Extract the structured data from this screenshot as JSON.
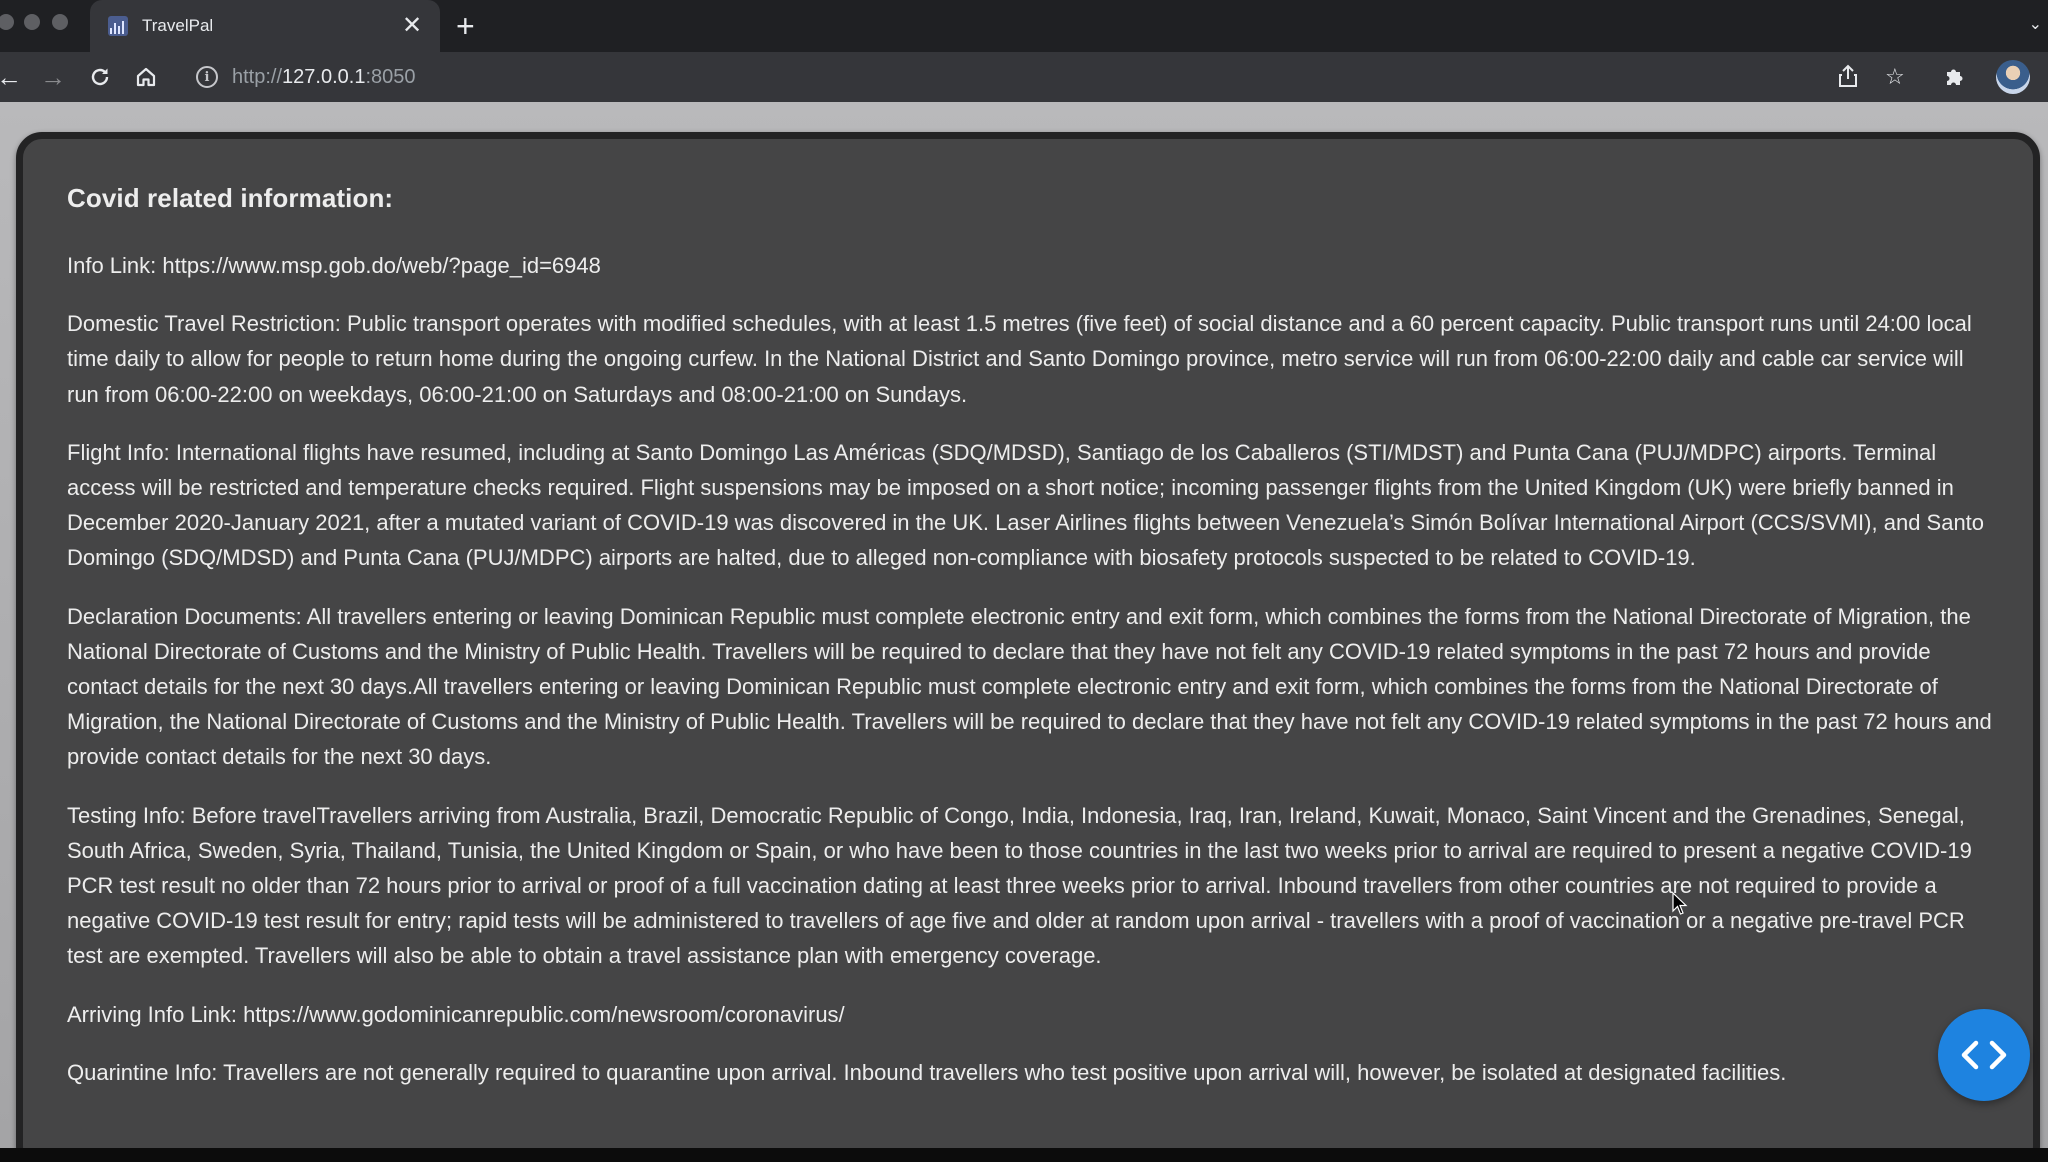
{
  "browser": {
    "tab_title": "TravelPal",
    "tab_close": "✕",
    "new_tab": "+",
    "url_scheme": "http://",
    "url_host": "127.0.0.1",
    "url_port": ":8050",
    "icons": [
      "back-icon",
      "forward-icon",
      "reload-icon",
      "home-icon",
      "info-icon",
      "share-icon",
      "bookmark-star-icon",
      "extensions-icon",
      "profile-avatar"
    ]
  },
  "page": {
    "heading": "Covid related information:",
    "info_link": "Info Link: https://www.msp.gob.do/web/?page_id=6948",
    "domestic": "Domestic Travel Restriction: Public transport operates with modified schedules, with at least 1.5 metres (five feet) of social distance and a 60 percent capacity. Public transport runs until 24:00 local time daily to allow for people to return home during the ongoing curfew. In the National District and Santo Domingo province, metro service will run from 06:00-22:00 daily and cable car service will run from 06:00-22:00 on weekdays, 06:00-21:00 on Saturdays and 08:00-21:00 on Sundays.",
    "flight": "Flight Info: International flights have resumed, including at Santo Domingo Las Américas (SDQ/MDSD), Santiago de los Caballeros (STI/MDST) and Punta Cana (PUJ/MDPC) airports. Terminal access will be restricted and temperature checks required. Flight suspensions may be imposed on a short notice; incoming passenger flights from the United Kingdom (UK) were briefly banned in December 2020-January 2021, after a mutated variant of COVID-19 was discovered in the UK. Laser Airlines flights between Venezuela’s Simón Bolívar International Airport (CCS/SVMI), and Santo Domingo (SDQ/MDSD) and Punta Cana (PUJ/MDPC) airports are halted, due to alleged non-compliance with biosafety protocols suspected to be related to COVID-19.",
    "declaration": "Declaration Documents: All travellers entering or leaving Dominican Republic must complete electronic entry and exit form, which combines the forms from the National Directorate of Migration, the National Directorate of Customs and the Ministry of Public Health. Travellers will be required to declare that they have not felt any COVID-19 related symptoms in the past 72 hours and provide contact details for the next 30 days.All travellers entering or leaving Dominican Republic must complete electronic entry and exit form, which combines the forms from the National Directorate of Migration, the National Directorate of Customs and the Ministry of Public Health. Travellers will be required to declare that they have not felt any COVID-19 related symptoms in the past 72 hours and provide contact details for the next 30 days.",
    "testing": "Testing Info: Before travelTravellers arriving from Australia, Brazil, Democratic Republic of Congo, India, Indonesia, Iraq, Iran, Ireland, Kuwait, Monaco, Saint Vincent and the Grenadines, Senegal, South Africa, Sweden, Syria, Thailand, Tunisia, the United Kingdom or Spain, or who have been to those countries in the last two weeks prior to arrival are required to present a negative COVID-19 PCR test result no older than 72 hours prior to arrival or proof of a full vaccination dating at least three weeks prior to arrival. Inbound travellers from other countries are not required to provide a negative COVID-19 test result for entry; rapid tests will be administered to travellers of age five and older at random upon arrival - travellers with a proof of vaccination or a negative pre-travel PCR test are exempted. Travellers will also be able to obtain a travel assistance plan with emergency coverage.",
    "arriving_link": "Arriving Info Link: https://www.godominicanrepublic.com/newsroom/coronavirus/",
    "quarantine": "Quarintine Info: Travellers are not generally required to quarantine upon arrival. Inbound travellers who test positive upon arrival will, however, be isolated at designated facilities."
  },
  "colors": {
    "card_bg": "#454546",
    "card_border": "#232324",
    "text": "#ededed",
    "fab": "#1e83e0"
  }
}
